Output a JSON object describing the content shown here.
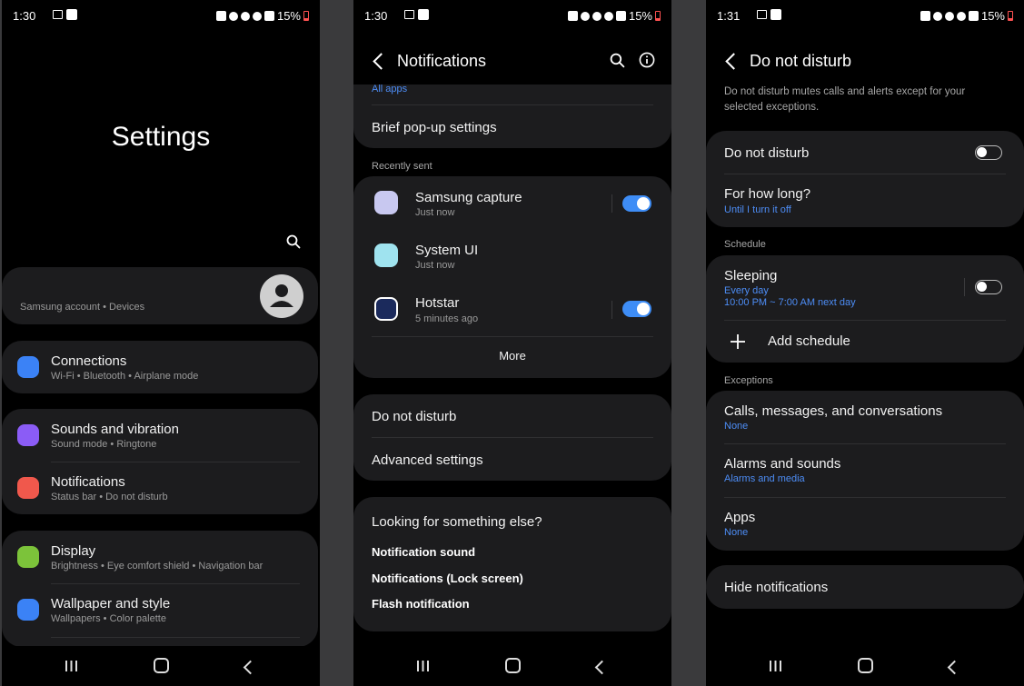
{
  "screens": [
    {
      "status": {
        "time": "1:30",
        "battery": "15%"
      },
      "title": "Settings",
      "account": {
        "text": "Samsung account  •  Devices"
      },
      "items": [
        {
          "title": "Connections",
          "subtitle": "Wi-Fi  •  Bluetooth  •  Airplane mode",
          "icon": "wifi-icon",
          "color": "#3b82f6"
        },
        {
          "title": "Sounds and vibration",
          "subtitle": "Sound mode  •  Ringtone",
          "icon": "speaker-icon",
          "color": "#8b5cf6"
        },
        {
          "title": "Notifications",
          "subtitle": "Status bar  •  Do not disturb",
          "icon": "notification-icon",
          "color": "#f0584c"
        },
        {
          "title": "Display",
          "subtitle": "Brightness  •  Eye comfort shield  •  Navigation bar",
          "icon": "sun-icon",
          "color": "#7cc33a"
        },
        {
          "title": "Wallpaper and style",
          "subtitle": "Wallpapers  •  Color palette",
          "icon": "wallpaper-icon",
          "color": "#3b82f6"
        }
      ]
    },
    {
      "status": {
        "time": "1:30",
        "battery": "15%"
      },
      "title": "Notifications",
      "all_apps": "All apps",
      "brief_popup": "Brief pop-up settings",
      "recently_sent_header": "Recently sent",
      "recent": [
        {
          "name": "Samsung capture",
          "time": "Just now",
          "toggle": true
        },
        {
          "name": "System UI",
          "time": "Just now",
          "toggle": false
        },
        {
          "name": "Hotstar",
          "time": "5 minutes ago",
          "toggle": true
        }
      ],
      "more": "More",
      "dnd": "Do not disturb",
      "advanced": "Advanced settings",
      "looking": "Looking for something else?",
      "links": [
        "Notification sound",
        "Notifications (Lock screen)",
        "Flash notification"
      ]
    },
    {
      "status": {
        "time": "1:31",
        "battery": "15%"
      },
      "title": "Do not disturb",
      "description": "Do not disturb mutes calls and alerts except for your selected exceptions.",
      "dnd_toggle_label": "Do not disturb",
      "dnd_on": false,
      "how_long": {
        "title": "For how long?",
        "value": "Until I turn it off"
      },
      "schedule_header": "Schedule",
      "sleeping": {
        "title": "Sleeping",
        "days": "Every day",
        "time": "10:00 PM ~ 7:00 AM next day",
        "on": false
      },
      "add_schedule": "Add schedule",
      "exceptions_header": "Exceptions",
      "exceptions": [
        {
          "title": "Calls, messages, and conversations",
          "value": "None"
        },
        {
          "title": "Alarms and sounds",
          "value": "Alarms and media"
        },
        {
          "title": "Apps",
          "value": "None"
        }
      ],
      "hide_notifications": "Hide notifications"
    }
  ]
}
